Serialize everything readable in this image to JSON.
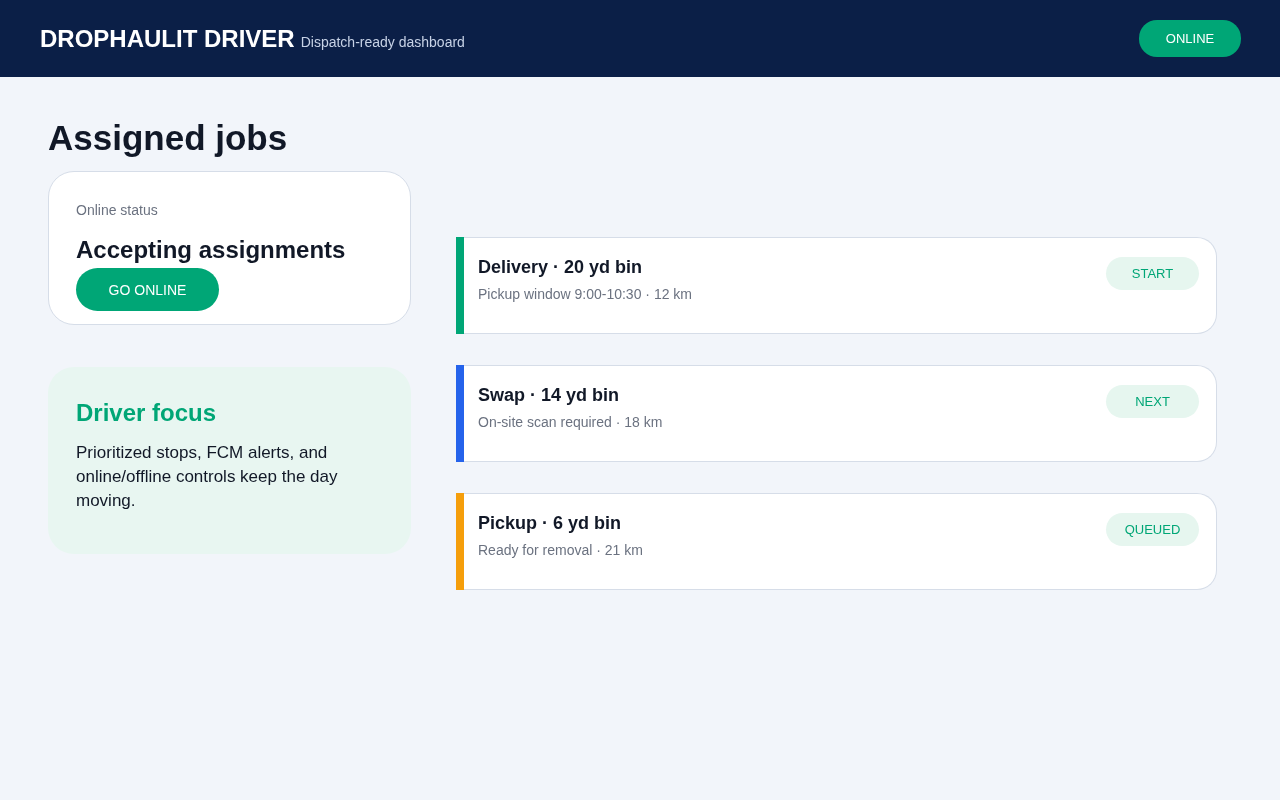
{
  "header": {
    "brand": "DROPHAULIT DRIVER",
    "tagline": "Dispatch-ready dashboard",
    "status_button": "ONLINE"
  },
  "page_title": "Assigned jobs",
  "status_card": {
    "label": "Online status",
    "heading": "Accepting assignments",
    "button": "GO ONLINE"
  },
  "focus_card": {
    "title": "Driver focus",
    "text": "Prioritized stops, FCM alerts, and online/offline controls keep the day moving."
  },
  "jobs": [
    {
      "title": "Delivery · 20 yd bin",
      "detail": "Pickup window 9:00-10:30 · 12 km",
      "action": "START",
      "color": "#00a676"
    },
    {
      "title": "Swap · 14 yd bin",
      "detail": "On-site scan required · 18 km",
      "action": "NEXT",
      "color": "#2563eb"
    },
    {
      "title": "Pickup · 6 yd bin",
      "detail": "Ready for removal · 21 km",
      "action": "QUEUED",
      "color": "#f59e0b"
    }
  ]
}
